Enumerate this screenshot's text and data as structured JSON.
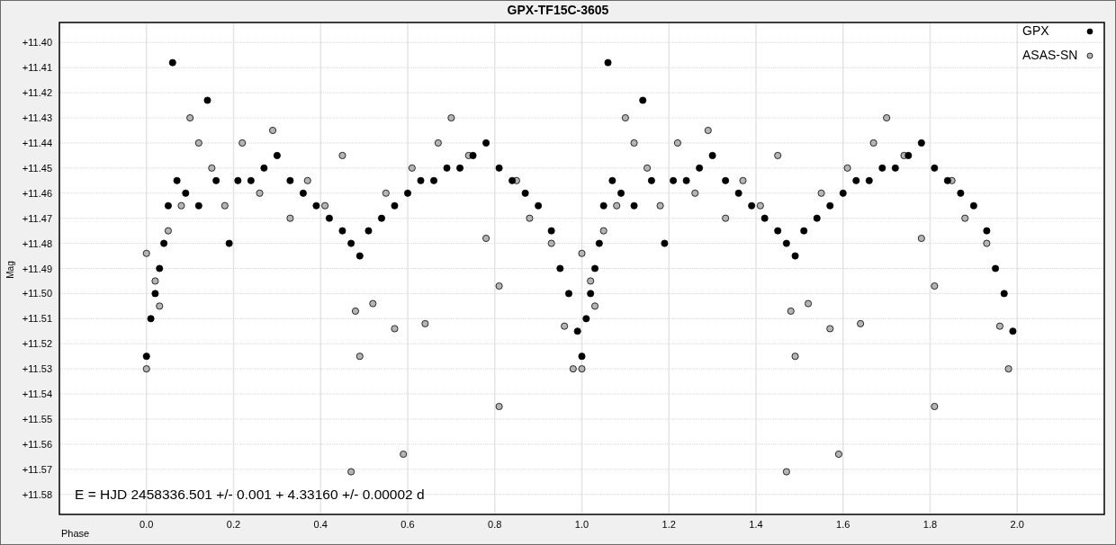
{
  "plot": {
    "annotation": "E = HJD 2458336.501 +/- 0.001 + 4.33160 +/- 0.00002 d",
    "chart_data": {
      "type": "scatter",
      "title": "GPX-TF15C-3605",
      "xlabel": "Phase",
      "ylabel": "Mag",
      "xlim": [
        -0.2,
        2.2
      ],
      "ylim": [
        11.588,
        11.392
      ],
      "grid": true,
      "xticks": [
        {
          "value": 0,
          "label": "0.0"
        },
        {
          "value": 0.2,
          "label": "0.2"
        },
        {
          "value": 0.4,
          "label": "0.4"
        },
        {
          "value": 0.6,
          "label": "0.6"
        },
        {
          "value": 0.8,
          "label": "0.8"
        },
        {
          "value": 1,
          "label": "1.0"
        },
        {
          "value": 1.2,
          "label": "1.2"
        },
        {
          "value": 1.4,
          "label": "1.4"
        },
        {
          "value": 1.6,
          "label": "1.6"
        },
        {
          "value": 1.8,
          "label": "1.8"
        },
        {
          "value": 2,
          "label": "2.0"
        }
      ],
      "yticks": [
        {
          "value": 11.4,
          "label": "+11.40"
        },
        {
          "value": 11.41,
          "label": "+11.41"
        },
        {
          "value": 11.42,
          "label": "+11.42"
        },
        {
          "value": 11.43,
          "label": "+11.43"
        },
        {
          "value": 11.44,
          "label": "+11.44"
        },
        {
          "value": 11.45,
          "label": "+11.45"
        },
        {
          "value": 11.46,
          "label": "+11.46"
        },
        {
          "value": 11.47,
          "label": "+11.47"
        },
        {
          "value": 11.48,
          "label": "+11.48"
        },
        {
          "value": 11.49,
          "label": "+11.49"
        },
        {
          "value": 11.5,
          "label": "+11.50"
        },
        {
          "value": 11.51,
          "label": "+11.51"
        },
        {
          "value": 11.52,
          "label": "+11.52"
        },
        {
          "value": 11.53,
          "label": "+11.53"
        },
        {
          "value": 11.54,
          "label": "+11.54"
        },
        {
          "value": 11.55,
          "label": "+11.55"
        },
        {
          "value": 11.56,
          "label": "+11.56"
        },
        {
          "value": 11.57,
          "label": "+11.57"
        },
        {
          "value": 11.58,
          "label": "+11.58"
        }
      ],
      "series": [
        {
          "name": "ASAS-SN",
          "color": "#b4b4b4",
          "x": [
            0.0,
            0.0,
            0.02,
            0.03,
            0.05,
            0.08,
            0.1,
            0.12,
            0.15,
            0.18,
            0.22,
            0.26,
            0.29,
            0.33,
            0.37,
            0.41,
            0.45,
            0.47,
            0.48,
            0.49,
            0.52,
            0.55,
            0.57,
            0.59,
            0.61,
            0.64,
            0.67,
            0.7,
            0.74,
            0.78,
            0.81,
            0.81,
            0.85,
            0.88,
            0.93,
            0.96,
            0.98,
            1.0,
            1.0,
            1.02,
            1.03,
            1.05,
            1.08,
            1.1,
            1.12,
            1.15,
            1.18,
            1.22,
            1.26,
            1.29,
            1.33,
            1.37,
            1.41,
            1.45,
            1.47,
            1.48,
            1.49,
            1.52,
            1.55,
            1.57,
            1.59,
            1.61,
            1.64,
            1.67,
            1.7,
            1.74,
            1.78,
            1.81,
            1.81,
            1.85,
            1.88,
            1.93,
            1.96,
            1.98
          ],
          "values": [
            11.53,
            11.484,
            11.495,
            11.505,
            11.475,
            11.465,
            11.43,
            11.44,
            11.45,
            11.465,
            11.44,
            11.46,
            11.435,
            11.47,
            11.455,
            11.465,
            11.445,
            11.571,
            11.507,
            11.525,
            11.504,
            11.46,
            11.514,
            11.564,
            11.45,
            11.512,
            11.44,
            11.43,
            11.445,
            11.478,
            11.497,
            11.545,
            11.455,
            11.47,
            11.48,
            11.513,
            11.53,
            11.53,
            11.484,
            11.495,
            11.505,
            11.475,
            11.465,
            11.43,
            11.44,
            11.45,
            11.465,
            11.44,
            11.46,
            11.435,
            11.47,
            11.455,
            11.465,
            11.445,
            11.571,
            11.507,
            11.525,
            11.504,
            11.46,
            11.514,
            11.564,
            11.45,
            11.512,
            11.44,
            11.43,
            11.445,
            11.478,
            11.497,
            11.545,
            11.455,
            11.47,
            11.48,
            11.513,
            11.53
          ]
        },
        {
          "name": "GPX",
          "color": "#000000",
          "x": [
            0.0,
            0.01,
            0.02,
            0.03,
            0.04,
            0.05,
            0.06,
            0.07,
            0.09,
            0.12,
            0.14,
            0.16,
            0.19,
            0.21,
            0.24,
            0.27,
            0.3,
            0.33,
            0.36,
            0.39,
            0.42,
            0.45,
            0.47,
            0.49,
            0.51,
            0.54,
            0.57,
            0.6,
            0.63,
            0.66,
            0.69,
            0.72,
            0.75,
            0.78,
            0.81,
            0.84,
            0.87,
            0.9,
            0.93,
            0.95,
            0.97,
            0.99,
            1.0,
            1.01,
            1.02,
            1.03,
            1.04,
            1.05,
            1.06,
            1.07,
            1.09,
            1.12,
            1.14,
            1.16,
            1.19,
            1.21,
            1.24,
            1.27,
            1.3,
            1.33,
            1.36,
            1.39,
            1.42,
            1.45,
            1.47,
            1.49,
            1.51,
            1.54,
            1.57,
            1.6,
            1.63,
            1.66,
            1.69,
            1.72,
            1.75,
            1.78,
            1.81,
            1.84,
            1.87,
            1.9,
            1.93,
            1.95,
            1.97,
            1.99
          ],
          "values": [
            11.525,
            11.51,
            11.5,
            11.49,
            11.48,
            11.465,
            11.408,
            11.455,
            11.46,
            11.465,
            11.423,
            11.455,
            11.48,
            11.455,
            11.455,
            11.45,
            11.445,
            11.455,
            11.46,
            11.465,
            11.47,
            11.475,
            11.48,
            11.485,
            11.475,
            11.47,
            11.465,
            11.46,
            11.455,
            11.455,
            11.45,
            11.45,
            11.445,
            11.44,
            11.45,
            11.455,
            11.46,
            11.465,
            11.475,
            11.49,
            11.5,
            11.515,
            11.525,
            11.51,
            11.5,
            11.49,
            11.48,
            11.465,
            11.408,
            11.455,
            11.46,
            11.465,
            11.423,
            11.455,
            11.48,
            11.455,
            11.455,
            11.45,
            11.445,
            11.455,
            11.46,
            11.465,
            11.47,
            11.475,
            11.48,
            11.485,
            11.475,
            11.47,
            11.465,
            11.46,
            11.455,
            11.455,
            11.45,
            11.45,
            11.445,
            11.44,
            11.45,
            11.455,
            11.46,
            11.465,
            11.475,
            11.49,
            11.5,
            11.515
          ]
        }
      ]
    }
  }
}
